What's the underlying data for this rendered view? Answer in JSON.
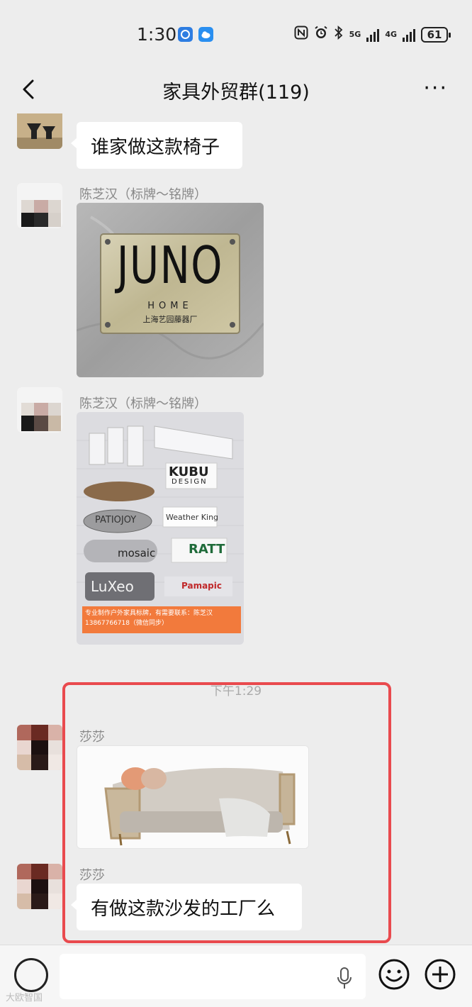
{
  "status_bar": {
    "time": "1:30",
    "network_left": "5G",
    "network_right": "4G",
    "battery": "61"
  },
  "header": {
    "title": "家具外贸群(119)",
    "more": "···"
  },
  "messages": [
    {
      "type": "text",
      "text": "谁家做这款椅子"
    },
    {
      "type": "image",
      "sender": "陈芝汉（标牌～铭牌）",
      "image": {
        "brand": "JUNO",
        "sub": "HOME",
        "factory": "上海艺园藤器厂"
      }
    },
    {
      "type": "image",
      "sender": "陈芝汉（标牌～铭牌）",
      "image": {
        "labels": [
          "KUBU",
          "DESIGN",
          "PATIOJOY",
          "Weather King",
          "mosaic",
          "RATT",
          "LuXeo",
          "Pamapic"
        ],
        "ad_text": "专业制作户外家具标牌，有需要联系：陈芝汉 13867766718（微信同步）"
      }
    },
    {
      "type": "timestamp",
      "text": "下午1:29"
    },
    {
      "type": "image",
      "sender": "莎莎"
    },
    {
      "type": "text",
      "sender": "莎莎",
      "text": "有做这款沙发的工厂么"
    }
  ],
  "watermark": "大欧智国",
  "colors": {
    "background": "#ededed",
    "highlight": "#e94a4e",
    "bubble": "#ffffff"
  }
}
